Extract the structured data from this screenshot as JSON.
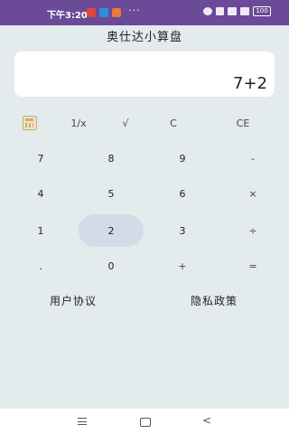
{
  "status_bar": {
    "time": "下午3:20",
    "more": "···",
    "battery": "100"
  },
  "app": {
    "title": "奥仕达小算盘"
  },
  "display": {
    "expression": "7+2"
  },
  "keys": {
    "inverse": "1/x",
    "sqrt": "√",
    "clear": "C",
    "clear_entry": "CE",
    "seven": "7",
    "eight": "8",
    "nine": "9",
    "minus": "-",
    "four": "4",
    "five": "5",
    "six": "6",
    "multiply": "×",
    "one": "1",
    "two": "2",
    "three": "3",
    "divide": "÷",
    "dot": ".",
    "zero": "0",
    "plus": "+",
    "equals": "="
  },
  "footer": {
    "user_agreement": "用户协议",
    "privacy_policy": "隐私政策"
  }
}
